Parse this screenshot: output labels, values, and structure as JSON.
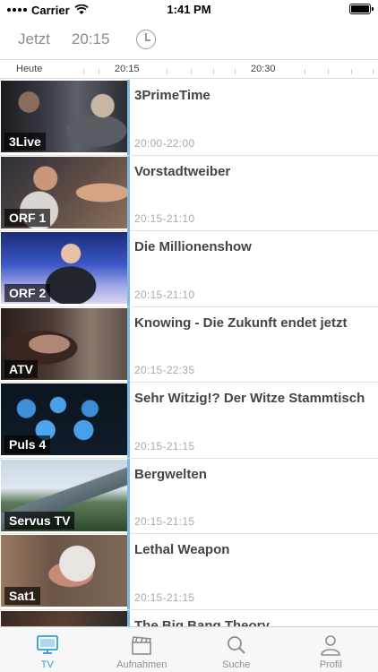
{
  "status_bar": {
    "carrier": "Carrier",
    "time": "1:41 PM"
  },
  "time_selector": {
    "now": "Jetzt",
    "prime": "20:15"
  },
  "timeline": {
    "day": "Heute",
    "marks": [
      "20:15",
      "20:30"
    ]
  },
  "programs": [
    {
      "channel": "3Live",
      "title": "3PrimeTime",
      "time": "20:00-22:00"
    },
    {
      "channel": "ORF 1",
      "title": "Vorstadtweiber",
      "time": "20:15-21:10"
    },
    {
      "channel": "ORF 2",
      "title": "Die Millionenshow",
      "time": "20:15-21:10"
    },
    {
      "channel": "ATV",
      "title": "Knowing - Die Zukunft endet jetzt",
      "time": "20:15-22:35"
    },
    {
      "channel": "Puls 4",
      "title": "Sehr Witzig!? Der Witze Stammtisch",
      "time": "20:15-21:15"
    },
    {
      "channel": "Servus TV",
      "title": "Bergwelten",
      "time": "20:15-21:15"
    },
    {
      "channel": "Sat1",
      "title": "Lethal Weapon",
      "time": "20:15-21:15"
    },
    {
      "channel": "",
      "title": "The Big Bang Theory",
      "time": ""
    }
  ],
  "tabs": [
    {
      "label": "TV",
      "icon": "tv-icon",
      "active": true
    },
    {
      "label": "Aufnahmen",
      "icon": "clapperboard-icon",
      "active": false
    },
    {
      "label": "Suche",
      "icon": "search-icon",
      "active": false
    },
    {
      "label": "Profil",
      "icon": "profile-icon",
      "active": false
    }
  ],
  "colors": {
    "accent": "#2a9fd6",
    "progress": "#7fb8e0"
  }
}
